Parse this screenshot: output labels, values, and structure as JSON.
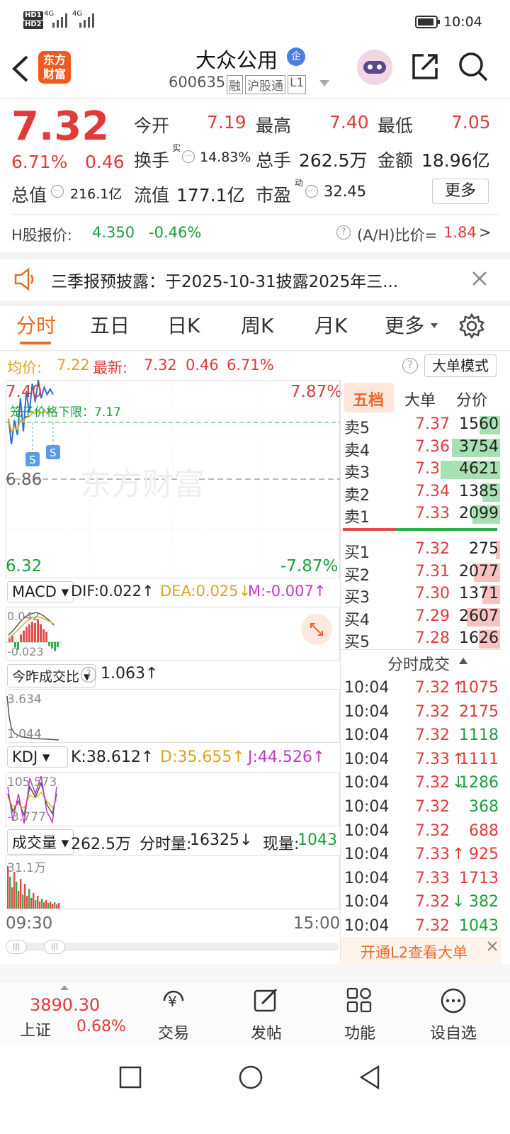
{
  "status_bar": {
    "net1": "HD1",
    "net2": "HD2",
    "sig1": "4G",
    "sig2": "4G",
    "time": "10:04"
  },
  "header": {
    "title": "大众公用",
    "badge": "企",
    "code": "600635",
    "tags": [
      "融",
      "沪股通",
      "L1"
    ],
    "logo_line1": "东方",
    "logo_line2": "财富"
  },
  "quote": {
    "price": "7.32",
    "change_pct": "6.71%",
    "change": "0.46",
    "open_label": "今开",
    "open": "7.19",
    "high_label": "最高",
    "high": "7.40",
    "low_label": "最低",
    "low": "7.05",
    "turnover_label": "换手",
    "turnover_sup": "实",
    "turnover": "14.83%",
    "volume_label": "总手",
    "volume": "262.5万",
    "amount_label": "金额",
    "amount": "18.96亿",
    "mktcap_label": "总值",
    "mktcap": "216.1亿",
    "float_label": "流值",
    "float": "177.1亿",
    "pe_label": "市盈",
    "pe_sup": "动",
    "pe": "32.45",
    "more_label": "更多"
  },
  "hshare": {
    "label": "H股报价:",
    "price": "4.350",
    "change": "-0.46%",
    "ratio_label": "(A/H)比价=",
    "ratio": "1.84",
    "arrow": ">"
  },
  "notice": {
    "text": "三季报预披露：于2025-10-31披露2025年三..."
  },
  "tabs": [
    "分时",
    "五日",
    "日K",
    "周K",
    "月K",
    "更多"
  ],
  "active_tab": "分时",
  "info_line": {
    "avg_label": "均价:",
    "avg": "7.22",
    "latest_label": "最新:",
    "latest": "7.32",
    "chg": "0.46",
    "pct": "6.71%",
    "mode_button": "大单模式"
  },
  "chart": {
    "y_top": "7.40",
    "y_mid": "6.86",
    "y_bottom": "6.32",
    "pct_top": "7.87%",
    "pct_bottom": "-7.87%",
    "limit_label": "笼子价格下限：7.17",
    "watermark": "东方财富",
    "time_start": "09:30",
    "time_end": "15:00"
  },
  "chart_data": {
    "type": "line",
    "x_range": [
      "09:30",
      "15:00"
    ],
    "ylim": [
      6.32,
      7.4
    ],
    "reference": 6.86,
    "series": [
      {
        "values": [
          7.19,
          7.05,
          7.18,
          7.1,
          7.3,
          7.12,
          7.34,
          7.22,
          7.38,
          7.28,
          7.4,
          7.3,
          7.36,
          7.32,
          7.35,
          7.32
        ]
      },
      {
        "values": [
          7.19,
          7.12,
          7.14,
          7.13,
          7.18,
          7.17,
          7.2,
          7.2,
          7.22,
          7.22,
          7.23,
          7.22,
          7.23,
          7.22,
          7.23,
          7.22
        ]
      }
    ]
  },
  "macd": {
    "selector": "MACD",
    "dif": "DIF:0.022↑",
    "dea": "DEA:0.025↓",
    "m": "M:-0.007↑",
    "y_top": "0.042",
    "y_bottom": "-0.023"
  },
  "ratio_ind": {
    "selector": "今昨成交比",
    "value": "1.063↑",
    "y_top": "3.634",
    "y_bottom": "1.044"
  },
  "kdj": {
    "selector": "KDJ",
    "k": "K:38.612↑",
    "d": "D:35.655↑",
    "j": "J:44.526↑",
    "y_top": "105.573",
    "y_bottom": "-3.777"
  },
  "vol_ind": {
    "selector": "成交量",
    "total": "262.5万",
    "fs_label": "分时量:",
    "fs": "16325↓",
    "now_label": "现量:",
    "now": "1043",
    "y_top": "31.1万"
  },
  "orderbook": {
    "tabs": [
      "五档",
      "大单",
      "分价"
    ],
    "sells": [
      {
        "label": "卖5",
        "price": "7.37",
        "vol": "1560",
        "ratio": 0.26
      },
      {
        "label": "卖4",
        "price": "7.36",
        "vol": "3754",
        "ratio": 0.62
      },
      {
        "label": "卖3",
        "price": "7.35",
        "vol": "4621",
        "ratio": 0.76
      },
      {
        "label": "卖2",
        "price": "7.34",
        "vol": "1385",
        "ratio": 0.23
      },
      {
        "label": "卖1",
        "price": "7.33",
        "vol": "2099",
        "ratio": 0.35
      }
    ],
    "buys": [
      {
        "label": "买1",
        "price": "7.32",
        "vol": "275",
        "ratio": 0.05
      },
      {
        "label": "买2",
        "price": "7.31",
        "vol": "2077",
        "ratio": 0.34
      },
      {
        "label": "买3",
        "price": "7.30",
        "vol": "1371",
        "ratio": 0.23
      },
      {
        "label": "买4",
        "price": "7.29",
        "vol": "2607",
        "ratio": 0.43
      },
      {
        "label": "买5",
        "price": "7.28",
        "vol": "1626",
        "ratio": 0.27
      }
    ],
    "bs_ratio": 0.34
  },
  "trades": {
    "title": "分时成交",
    "rows": [
      {
        "time": "10:04",
        "price": "7.32",
        "arrow": "↑",
        "vol": "1075",
        "color": "red"
      },
      {
        "time": "10:04",
        "price": "7.32",
        "arrow": "",
        "vol": "2175",
        "color": "red"
      },
      {
        "time": "10:04",
        "price": "7.32",
        "arrow": "",
        "vol": "1118",
        "color": "green"
      },
      {
        "time": "10:04",
        "price": "7.33",
        "arrow": "↑",
        "vol": "1111",
        "color": "red"
      },
      {
        "time": "10:04",
        "price": "7.32",
        "arrow": "↓",
        "vol": "1286",
        "color": "green"
      },
      {
        "time": "10:04",
        "price": "7.32",
        "arrow": "",
        "vol": "368",
        "color": "green"
      },
      {
        "time": "10:04",
        "price": "7.32",
        "arrow": "",
        "vol": "688",
        "color": "red"
      },
      {
        "time": "10:04",
        "price": "7.33",
        "arrow": "↑",
        "vol": "925",
        "color": "red"
      },
      {
        "time": "10:04",
        "price": "7.33",
        "arrow": "",
        "vol": "1713",
        "color": "red"
      },
      {
        "time": "10:04",
        "price": "7.32",
        "arrow": "↓",
        "vol": "382",
        "color": "green"
      },
      {
        "time": "10:04",
        "price": "7.32",
        "arrow": "",
        "vol": "1043",
        "color": "green"
      }
    ],
    "l2_banner": "开通L2查看大单"
  },
  "bottom_nav": {
    "index_value": "3890.30",
    "index_name": "上证",
    "index_change": "0.68%",
    "items": [
      "交易",
      "发帖",
      "功能",
      "设自选"
    ]
  }
}
